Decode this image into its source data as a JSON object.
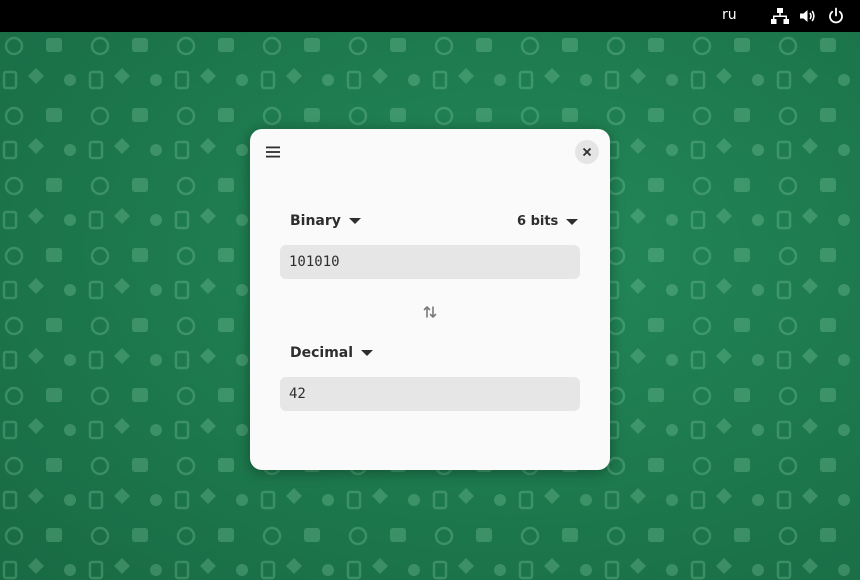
{
  "topbar": {
    "keyboard_layout": "ru",
    "icons": [
      "network-wired-icon",
      "volume-icon",
      "power-icon"
    ]
  },
  "window": {
    "menu_icon": "hamburger-menu-icon",
    "close_icon": "close-icon",
    "from": {
      "base": "Binary",
      "bits": "6 bits",
      "value": "101010"
    },
    "swap_icon": "swap-vertical-icon",
    "to": {
      "base": "Decimal",
      "value": "42"
    }
  },
  "colors": {
    "desktop_bg": "#1f7a4c",
    "topbar_bg": "#000000",
    "window_bg": "#fafafa",
    "field_bg": "#e6e6e6",
    "text": "#2e2e2e"
  }
}
